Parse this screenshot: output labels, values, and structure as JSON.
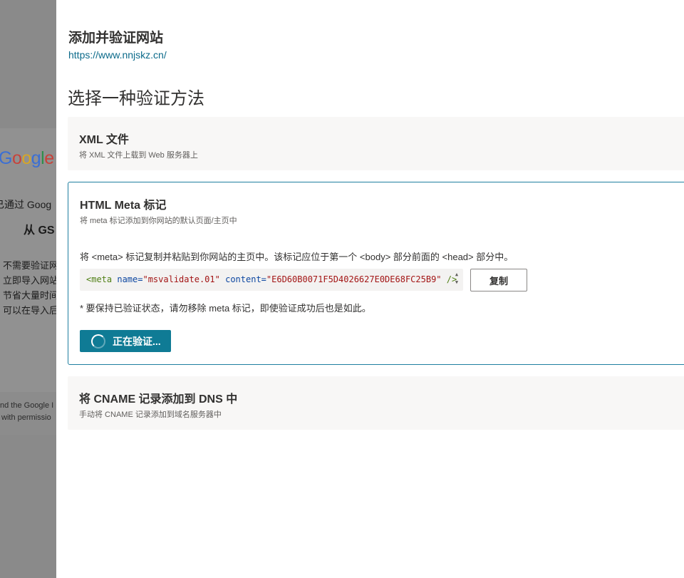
{
  "background": {
    "logo_letters": [
      {
        "char": "G",
        "color": "#3b6fd4"
      },
      {
        "char": "o",
        "color": "#c8423a"
      },
      {
        "char": "o",
        "color": "#d9a623"
      },
      {
        "char": "g",
        "color": "#3b6fd4"
      },
      {
        "char": "l",
        "color": "#2e8f4a"
      },
      {
        "char": "e",
        "color": "#c8423a"
      }
    ],
    "line1": "已通过 Goog",
    "line2": "从 GS",
    "bullets": [
      "不需要验证网",
      "立即导入网站",
      "节省大量时间",
      "可以在导入后"
    ],
    "footer1": "nd the Google I",
    "footer2": "with permissio"
  },
  "panel": {
    "title": "添加并验证网站",
    "url": "https://www.nnjskz.cn/",
    "heading": "选择一种验证方法"
  },
  "options": {
    "xml": {
      "title": "XML 文件",
      "desc": "将 XML 文件上载到 Web 服务器上"
    },
    "meta": {
      "title": "HTML Meta 标记",
      "desc": "将 meta 标记添加到你网站的默认页面/主页中",
      "instruction": "将 <meta> 标记复制并粘贴到你网站的主页中。该标记应位于第一个 <body> 部分前面的 <head> 部分中。",
      "code": {
        "open": "<meta",
        "attr1": "name=",
        "val1": "\"msvalidate.01\"",
        "attr2": "content=",
        "val2": "\"E6D60B0071F5D4026627E0DE68FC25B9\"",
        "close": "/>"
      },
      "copy_label": "复制",
      "note": "* 要保持已验证状态，请勿移除 meta 标记，即使验证成功后也是如此。",
      "verify_label": "正在验证..."
    },
    "cname": {
      "title": "将 CNAME 记录添加到 DNS 中",
      "desc": "手动将 CNAME 记录添加到域名服务器中"
    }
  }
}
